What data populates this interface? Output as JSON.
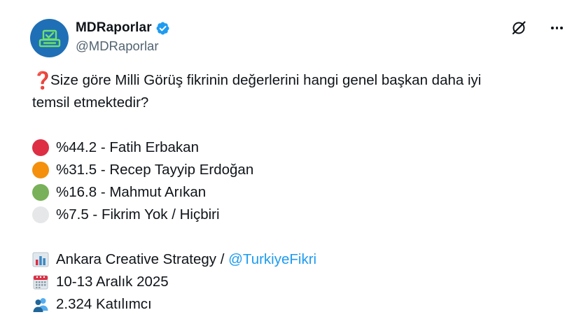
{
  "author": {
    "display_name": "MDRaporlar",
    "handle": "@MDRaporlar",
    "verified_icon": "verified-badge-icon",
    "avatar_color": "#1f6fb6",
    "avatar_icon": "ballot-box-icon"
  },
  "actions": {
    "grok_icon": "grok-icon",
    "more_icon": "more-options-icon"
  },
  "tweet": {
    "question_line1": "Size göre Milli Görüş fikrinin değerlerini hangi genel başkan daha iyi",
    "question_line2": "temsil etmektedir?",
    "question_mark_glyph": "❓",
    "results": [
      {
        "color": "#dd2e44",
        "text": "%44.2 - Fatih Erbakan"
      },
      {
        "color": "#f4900c",
        "text": "%31.5 - Recep Tayyip Erdoğan"
      },
      {
        "color": "#78b159",
        "text": "%16.8 - Mahmut Arıkan"
      },
      {
        "color": "#e6e7e8",
        "text": "%7.5 - Fikrim Yok / Hiçbiri"
      }
    ],
    "source_prefix": "Ankara Creative Strategy / ",
    "source_mention": "@TurkiyeFikri",
    "date": "10-13 Aralık 2025",
    "participants": "2.324 Katılımcı"
  }
}
